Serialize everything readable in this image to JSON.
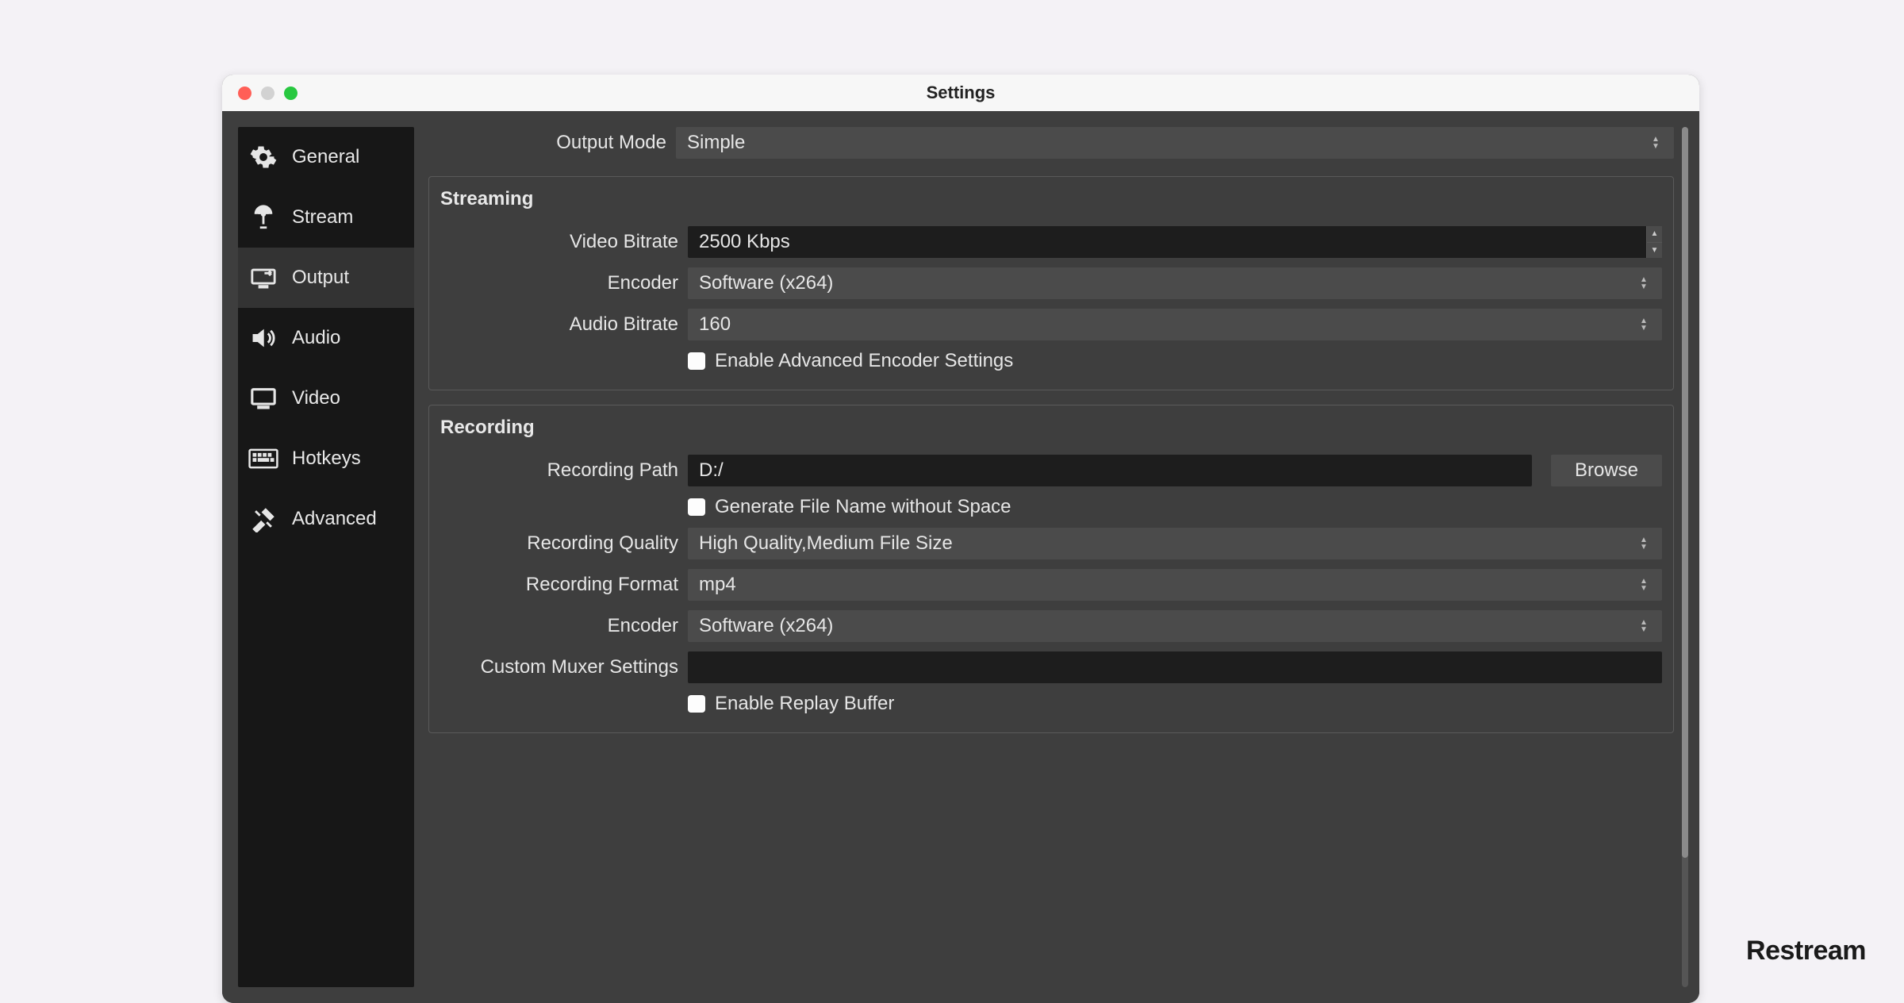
{
  "window": {
    "title": "Settings"
  },
  "sidebar": {
    "items": [
      {
        "label": "General",
        "icon": "gear-icon"
      },
      {
        "label": "Stream",
        "icon": "antenna-icon"
      },
      {
        "label": "Output",
        "icon": "monitor-arrow-icon"
      },
      {
        "label": "Audio",
        "icon": "speaker-icon"
      },
      {
        "label": "Video",
        "icon": "monitor-icon"
      },
      {
        "label": "Hotkeys",
        "icon": "keyboard-icon"
      },
      {
        "label": "Advanced",
        "icon": "tools-icon"
      }
    ],
    "active_index": 2
  },
  "output_mode": {
    "label": "Output Mode",
    "value": "Simple"
  },
  "streaming": {
    "title": "Streaming",
    "video_bitrate": {
      "label": "Video Bitrate",
      "value": "2500 Kbps"
    },
    "encoder": {
      "label": "Encoder",
      "value": "Software (x264)"
    },
    "audio_bitrate": {
      "label": "Audio Bitrate",
      "value": "160"
    },
    "advanced_checkbox": {
      "label": "Enable Advanced Encoder Settings",
      "checked": false
    }
  },
  "recording": {
    "title": "Recording",
    "path": {
      "label": "Recording Path",
      "value": "D:/"
    },
    "browse_label": "Browse",
    "no_space_checkbox": {
      "label": "Generate File Name without Space",
      "checked": false
    },
    "quality": {
      "label": "Recording Quality",
      "value": "High Quality,Medium File Size"
    },
    "format": {
      "label": "Recording Format",
      "value": "mp4"
    },
    "encoder": {
      "label": "Encoder",
      "value": "Software (x264)"
    },
    "muxer": {
      "label": "Custom Muxer Settings",
      "value": ""
    },
    "replay_checkbox": {
      "label": "Enable Replay Buffer",
      "checked": false
    }
  },
  "watermark": "Restream"
}
